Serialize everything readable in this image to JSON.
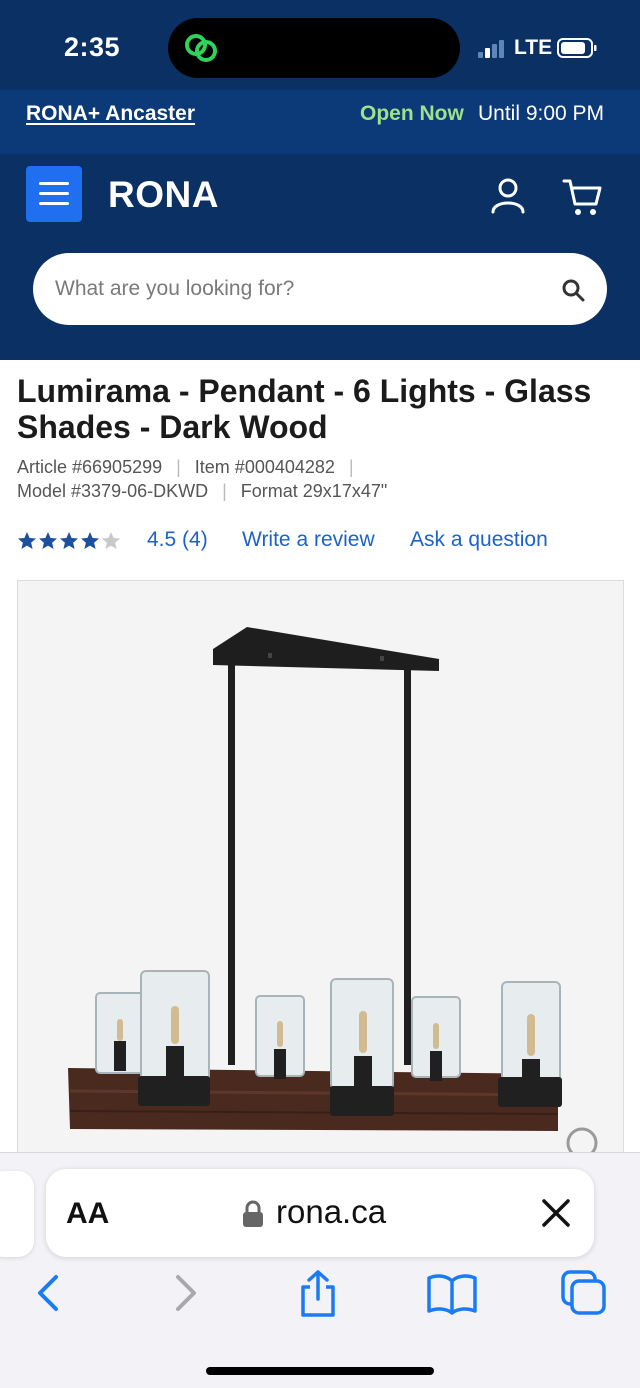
{
  "status_bar": {
    "time": "2:35",
    "network": "LTE"
  },
  "store_bar": {
    "store_name": "RONA+ Ancaster",
    "open_status": "Open Now",
    "hours": "Until 9:00 PM"
  },
  "header": {
    "logo_text": "RONA",
    "search_placeholder": "What are you looking for?"
  },
  "product": {
    "title": "Lumirama - Pendant - 6 Lights - Glass Shades - Dark Wood",
    "article": "Article #66905299",
    "item": "Item #000404282",
    "model": "Model #3379-06-DKWD",
    "format": "Format 29x17x47\"",
    "rating_value": 4.5,
    "rating_text": "4.5 (4)",
    "write_review": "Write a review",
    "ask_question": "Ask a question"
  },
  "safari": {
    "text_size_label": "AA",
    "domain": "rona.ca"
  },
  "icons": {
    "menu": "hamburger-icon",
    "account": "account-icon",
    "cart": "cart-icon",
    "search": "search-icon",
    "lock": "lock-icon",
    "close": "close-icon",
    "back": "back-icon",
    "forward": "forward-icon",
    "share": "share-icon",
    "bookmarks": "bookmarks-icon",
    "tabs": "tabs-icon"
  },
  "colors": {
    "header_navy": "#0a3064",
    "store_bar": "#0c3a78",
    "accent_blue": "#1f6ff0",
    "link_blue": "#1c63c5",
    "open_green": "#9fe08a",
    "safari_blue": "#1a7cf5"
  }
}
